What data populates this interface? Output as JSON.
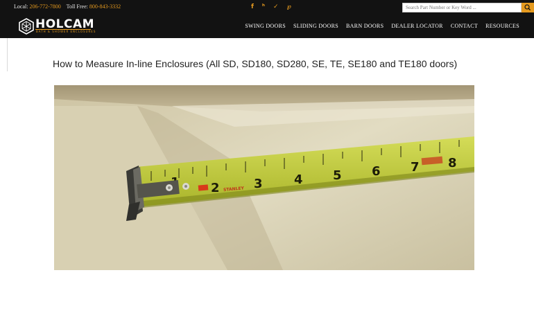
{
  "topbar": {
    "local_label": "Local:",
    "local_number": "206-772-7800",
    "tollfree_label": "Toll Free:",
    "tollfree_number": "800-843-3332",
    "socials": [
      {
        "icon": "facebook-icon",
        "glyph": "f"
      },
      {
        "icon": "houzz-icon",
        "glyph": "h"
      },
      {
        "icon": "twitter-icon",
        "glyph": "t"
      },
      {
        "icon": "pinterest-icon",
        "glyph": "p"
      }
    ],
    "search_placeholder": "Search Part Number or Key Word ...",
    "search_icon": "magnifier-icon"
  },
  "header": {
    "logo_text": "HOLCAM",
    "logo_tagline": "BATH & SHOWER ENCLOSURES",
    "nav": [
      "SWING DOORS",
      "SLIDING DOORS",
      "BARN DOORS",
      "DEALER LOCATOR",
      "CONTACT",
      "RESOURCES"
    ]
  },
  "main": {
    "title": "How to Measure In-line Enclosures (All SD, SD180, SD280, SE, TE, SE180 and TE180 doors)",
    "image": {
      "subject": "tape-measure-photo",
      "tape_numbers": [
        "1",
        "2",
        "3",
        "4",
        "5",
        "6",
        "7",
        "8"
      ],
      "tape_brand": "STANLEY"
    }
  },
  "colors": {
    "bar_bg": "#121212",
    "accent": "#e59a1f",
    "text": "#222222",
    "tape": "#c7d23e"
  }
}
